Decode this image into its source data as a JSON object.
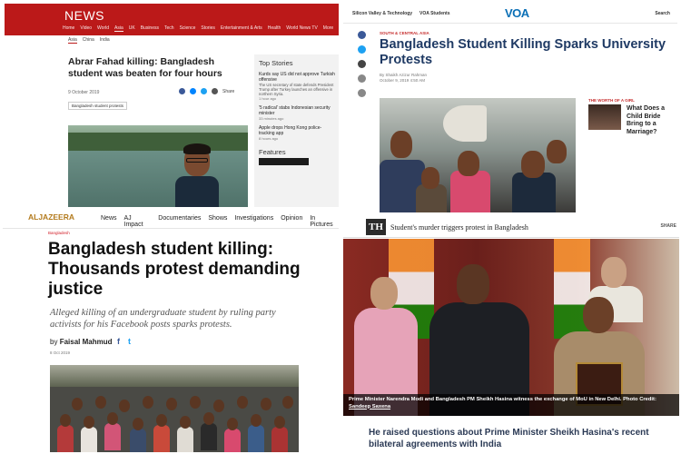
{
  "bbc": {
    "logo": "NEWS",
    "nav": [
      "Home",
      "Video",
      "World",
      "Asia",
      "UK",
      "Business",
      "Tech",
      "Science",
      "Stories",
      "Entertainment & Arts",
      "Health",
      "World News TV",
      "More"
    ],
    "subnav": [
      "Asia",
      "China",
      "India"
    ],
    "headline": "Abrar Fahad killing: Bangladesh student was beaten for four hours",
    "date": "9 October 2019",
    "share_label": "Share",
    "tag": "Bangladesh student protests",
    "top_stories_heading": "Top Stories",
    "top_stories": [
      {
        "title": "Kurds say US did not approve Turkish offensive",
        "desc": "The US secretary of state defends President Trump after Turkey launches an offensive in northern Syria.",
        "ago": "1 hour ago"
      },
      {
        "title": "'5 radical' stabs Indonesian security minister",
        "desc": "",
        "ago": "33 minutes ago"
      },
      {
        "title": "Apple drops Hong Kong police-tracking app",
        "desc": "",
        "ago": "8 hours ago"
      }
    ],
    "features_heading": "Features"
  },
  "voa": {
    "nav": [
      "Silicon Valley & Technology",
      "VOA Students"
    ],
    "logo": "VOA",
    "search_label": "Search",
    "kicker": "SOUTH & CENTRAL ASIA",
    "headline": "Bangladesh Student Killing Sparks University Protests",
    "byline": [
      "By Shaikh Azizur Rahman",
      "October 9, 2019 4:50 AM"
    ],
    "side_kicker": "THE WORTH OF A GIRL",
    "side_title": "What Does a Child Bride Bring to a Marriage?"
  },
  "aj": {
    "logo": "ALJAZEERA",
    "nav": [
      "News",
      "AJ Impact",
      "Documentaries",
      "Shows",
      "Investigations",
      "Opinion",
      "In Pictures"
    ],
    "kicker": "Bangladesh",
    "headline": "Bangladesh student killing: Thousands protest demanding justice",
    "sub": "Alleged killing of an undergraduate student by ruling party activists for his Facebook posts sparks protests.",
    "by_prefix": "by",
    "author": "Faisal Mahmud",
    "fb": "f",
    "tw": "t",
    "date": "8 Oct 2019"
  },
  "hindu": {
    "logo": "TH",
    "title": "Student's murder triggers protest in Bangladesh",
    "share": "SHARE",
    "caption": "Prime Minister Narendra Modi and Bangladesh PM Sheikh Hasina witness the exchange of MoU in New Delhi.",
    "credit_label": "Photo Credit:",
    "credit_name": "Sandeep Saxena",
    "quote": "He raised questions about Prime Minister Sheikh Hasina's recent bilateral agreements with India"
  },
  "colors": {
    "bbc_red": "#bb1919",
    "voa_blue": "#0a6fb6",
    "voa_headline": "#1f3a64",
    "aj_gold": "#b37a1c",
    "hindu_quote": "#2b3a55"
  }
}
